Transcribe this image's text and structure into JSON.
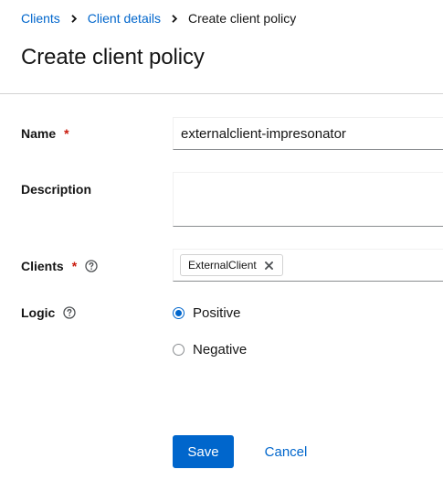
{
  "breadcrumb": {
    "items": [
      {
        "label": "Clients"
      },
      {
        "label": "Client details"
      }
    ],
    "current": "Create client policy"
  },
  "page": {
    "title": "Create client policy"
  },
  "form": {
    "name": {
      "label": "Name",
      "required_mark": "*",
      "value": "externalclient-impresonator"
    },
    "description": {
      "label": "Description",
      "value": ""
    },
    "clients": {
      "label": "Clients",
      "required_mark": "*",
      "chips": [
        "ExternalClient"
      ]
    },
    "logic": {
      "label": "Logic",
      "options": [
        {
          "label": "Positive",
          "selected": true
        },
        {
          "label": "Negative",
          "selected": false
        }
      ]
    }
  },
  "actions": {
    "save_label": "Save",
    "cancel_label": "Cancel"
  },
  "colors": {
    "accent": "#0066cc",
    "required": "#c9190b",
    "border": "#d2d2d2"
  },
  "icons": [
    "chevron-right-icon",
    "help-icon",
    "close-icon"
  ]
}
